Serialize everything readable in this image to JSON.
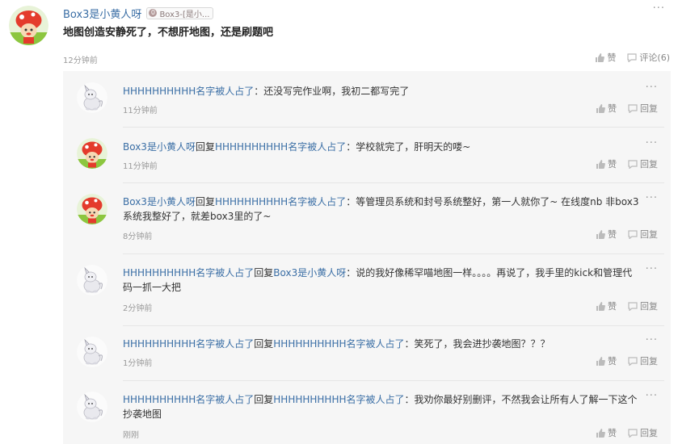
{
  "post": {
    "author": "Box3是小黄人呀",
    "badge_icon": "0",
    "badge": "Box3-[是小...",
    "content": "地图创造安静死了，不想肝地图，还是刷题吧",
    "time": "12分钟前",
    "like_label": "赞",
    "comment_label": "评论(6)"
  },
  "replies": [
    {
      "avatar": "cat-avatar",
      "author": "HHHHHHHHHH名字被人占了",
      "reply_word": "",
      "target": "",
      "colon": "：",
      "text": "还没写完作业啊，我初二都写完了",
      "time": "11分钟前",
      "like_label": "赞",
      "reply_label": "回复"
    },
    {
      "avatar": "mushroom-avatar",
      "author": "Box3是小黄人呀",
      "reply_word": "回复",
      "target": "HHHHHHHHHH名字被人占了",
      "colon": "：",
      "text": "学校就完了，肝明天的喽~",
      "time": "11分钟前",
      "like_label": "赞",
      "reply_label": "回复"
    },
    {
      "avatar": "mushroom-avatar",
      "author": "Box3是小黄人呀",
      "reply_word": "回复",
      "target": "HHHHHHHHHH名字被人占了",
      "colon": "：",
      "text": "等管理员系统和封号系统整好，第一人就你了~ 在线度nb 非box3系统我整好了，就差box3里的了~",
      "time": "8分钟前",
      "like_label": "赞",
      "reply_label": "回复"
    },
    {
      "avatar": "cat-avatar",
      "author": "HHHHHHHHHH名字被人占了",
      "reply_word": "回复",
      "target": "Box3是小黄人呀",
      "colon": "：",
      "text": "说的我好像稀罕喵地图一样。。。。再说了，我手里的kick和管理代码一抓一大把",
      "time": "2分钟前",
      "like_label": "赞",
      "reply_label": "回复"
    },
    {
      "avatar": "cat-avatar",
      "author": "HHHHHHHHHH名字被人占了",
      "reply_word": "回复",
      "target": "HHHHHHHHHH名字被人占了",
      "colon": "：",
      "text": "笑死了，我会进抄袭地图？？？",
      "time": "1分钟前",
      "like_label": "赞",
      "reply_label": "回复"
    },
    {
      "avatar": "cat-avatar",
      "author": "HHHHHHHHHH名字被人占了",
      "reply_word": "回复",
      "target": "HHHHHHHHHH名字被人占了",
      "colon": "：",
      "text": "我劝你最好别删评，不然我会让所有人了解一下这个抄袭地图",
      "time": "刚刚",
      "like_label": "赞",
      "reply_label": "回复"
    }
  ],
  "colors": {
    "link": "#3a6ea5",
    "reply_bg": "#f6f6f6",
    "muted": "#999999"
  }
}
